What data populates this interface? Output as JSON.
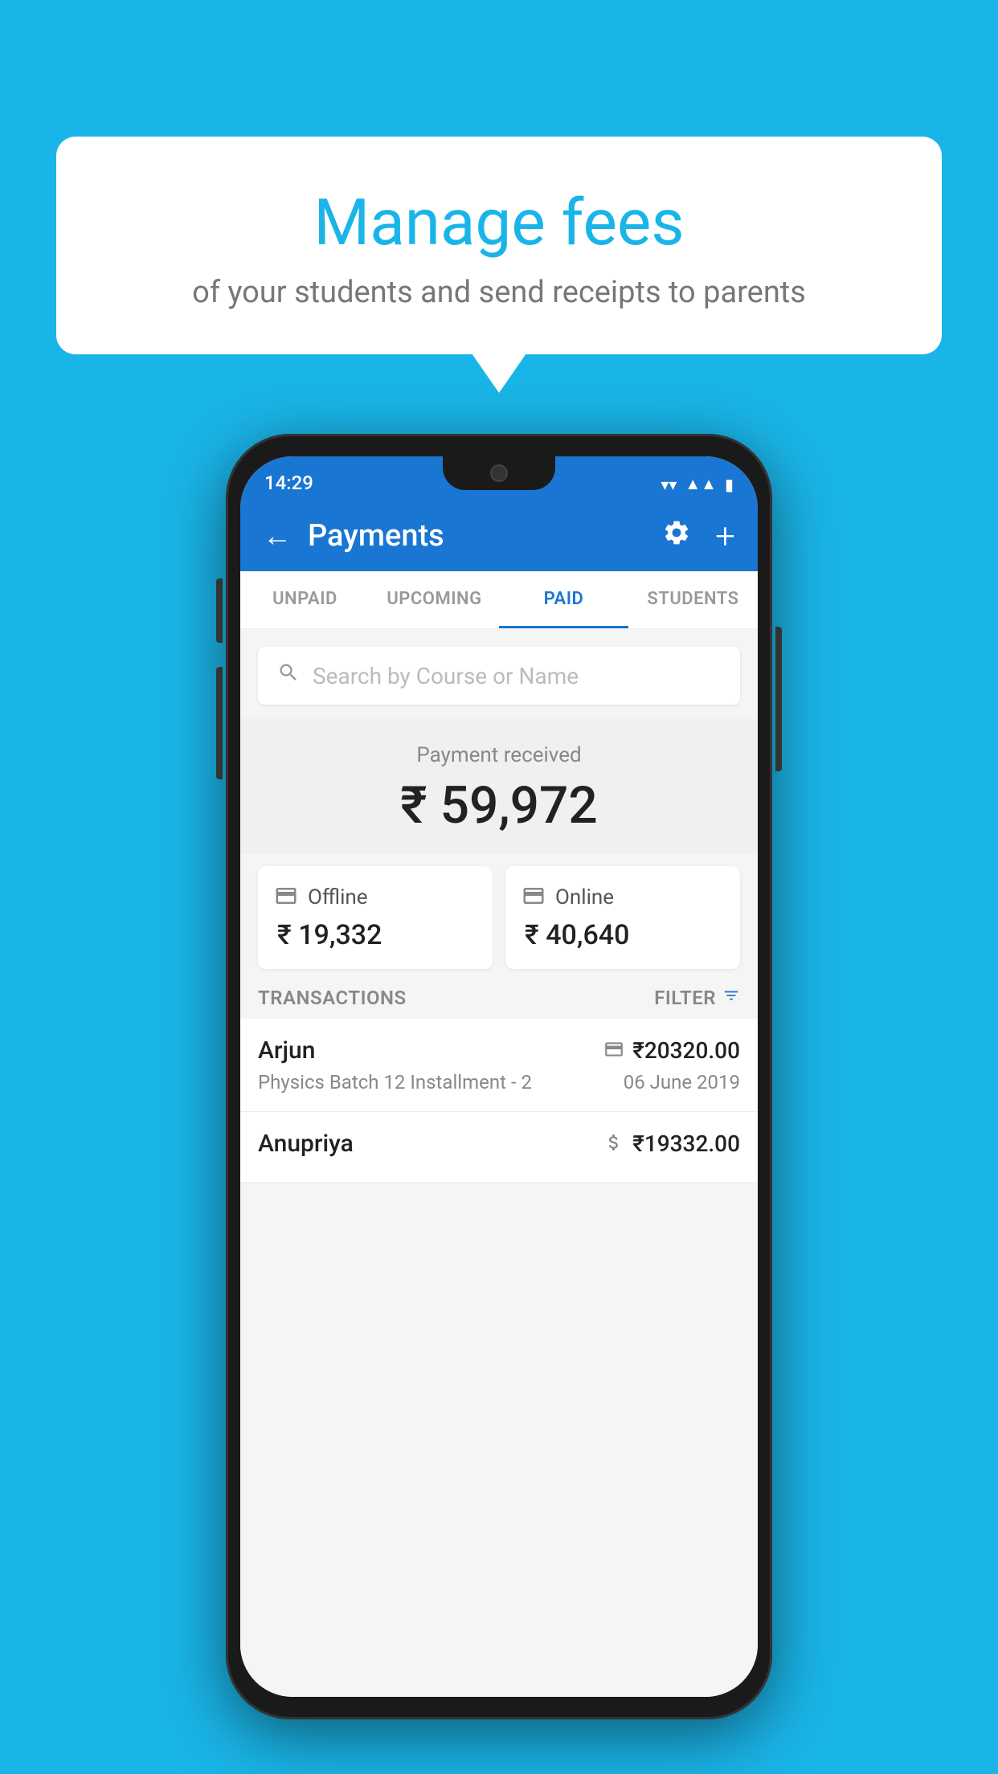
{
  "background_color": "#1ab5e8",
  "speech_bubble": {
    "title": "Manage fees",
    "subtitle": "of your students and send receipts to parents"
  },
  "status_bar": {
    "time": "14:29",
    "wifi_icon": "▼",
    "signal_icon": "▲",
    "battery_icon": "▮"
  },
  "app_bar": {
    "title": "Payments",
    "back_icon": "←",
    "gear_icon": "⚙",
    "plus_icon": "+"
  },
  "tabs": [
    {
      "label": "UNPAID",
      "active": false
    },
    {
      "label": "UPCOMING",
      "active": false
    },
    {
      "label": "PAID",
      "active": true
    },
    {
      "label": "STUDENTS",
      "active": false
    }
  ],
  "search": {
    "placeholder": "Search by Course or Name"
  },
  "payment_received": {
    "label": "Payment received",
    "amount": "₹ 59,972"
  },
  "payment_cards": [
    {
      "type": "Offline",
      "amount": "₹ 19,332",
      "icon": "💳"
    },
    {
      "type": "Online",
      "amount": "₹ 40,640",
      "icon": "💳"
    }
  ],
  "transactions_section": {
    "label": "TRANSACTIONS",
    "filter_label": "FILTER"
  },
  "transactions": [
    {
      "name": "Arjun",
      "course": "Physics Batch 12 Installment - 2",
      "amount": "₹20320.00",
      "date": "06 June 2019",
      "payment_type": "online"
    },
    {
      "name": "Anupriya",
      "course": "",
      "amount": "₹19332.00",
      "date": "",
      "payment_type": "offline"
    }
  ]
}
